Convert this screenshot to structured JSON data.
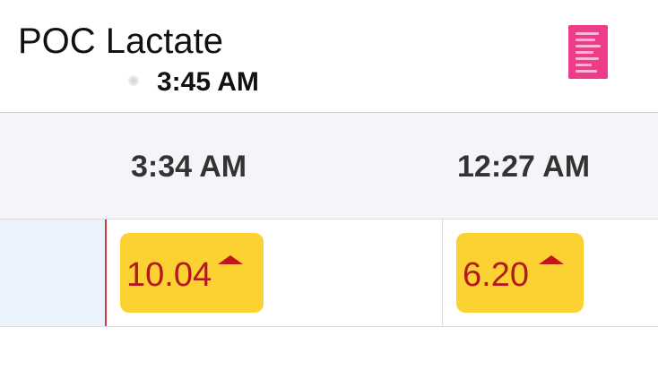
{
  "header": {
    "title": "POC Lactate",
    "updated_time": "3:45 AM",
    "document_icon": "document-icon",
    "icon_color": "#ef3c8a"
  },
  "columns": [
    {
      "time": "3:34 AM"
    },
    {
      "time": "12:27 AM"
    }
  ],
  "results": [
    {
      "value": "10.04",
      "flag": "high",
      "flag_icon": "up-arrow-icon"
    },
    {
      "value": "6.20",
      "flag": "high",
      "flag_icon": "up-arrow-icon"
    }
  ],
  "colors": {
    "chip_background": "#fbd232",
    "abnormal_text": "#b31b1b",
    "current_time_line": "#d23b3b",
    "header_row_background": "#f5f5f9",
    "label_cell_background": "#eaf3fb"
  }
}
